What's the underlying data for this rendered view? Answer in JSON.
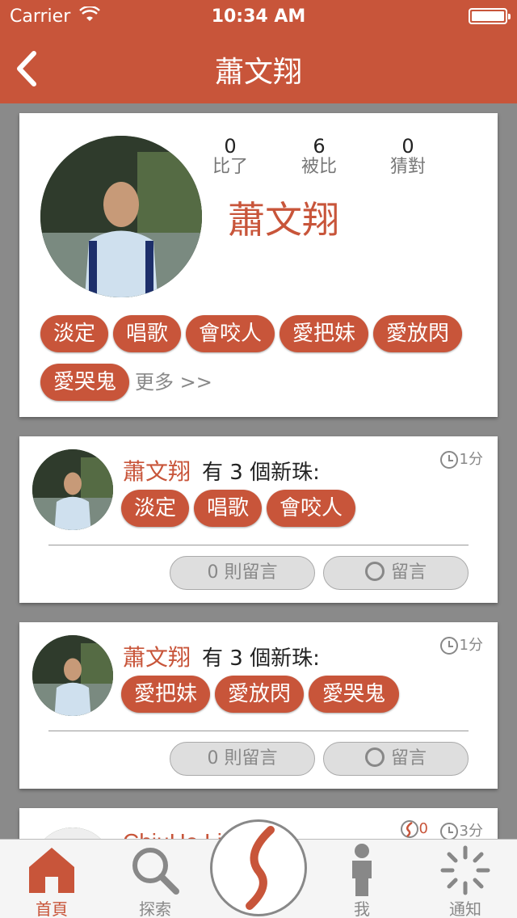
{
  "status_bar": {
    "carrier": "Carrier",
    "time": "10:34 AM"
  },
  "nav": {
    "title": "蕭文翔"
  },
  "profile": {
    "name": "蕭文翔",
    "stats": [
      {
        "value": "0",
        "label": "比了"
      },
      {
        "value": "6",
        "label": "被比"
      },
      {
        "value": "0",
        "label": "猜對"
      }
    ],
    "tags": [
      "淡定",
      "唱歌",
      "會咬人",
      "愛把妹",
      "愛放閃",
      "愛哭鬼"
    ],
    "more_label": "更多 >>"
  },
  "feed": [
    {
      "name": "蕭文翔",
      "text": "有 3 個新珠:",
      "time": "1分",
      "tags": [
        "淡定",
        "唱歌",
        "會咬人"
      ],
      "comments_label": "0 則留言",
      "comment_button": "留言"
    },
    {
      "name": "蕭文翔",
      "text": "有 3 個新珠:",
      "time": "1分",
      "tags": [
        "愛把妹",
        "愛放閃",
        "愛哭鬼"
      ],
      "comments_label": "0 則留言",
      "comment_button": "留言"
    }
  ],
  "partial_card": {
    "name": "ChiuHe Li",
    "count": "0",
    "time": "3分"
  },
  "tabbar": {
    "home": "首頁",
    "explore": "探索",
    "me": "我",
    "notifications": "通知"
  },
  "colors": {
    "accent": "#c8553a",
    "background": "#8a8a8a",
    "inactive": "#888888"
  }
}
